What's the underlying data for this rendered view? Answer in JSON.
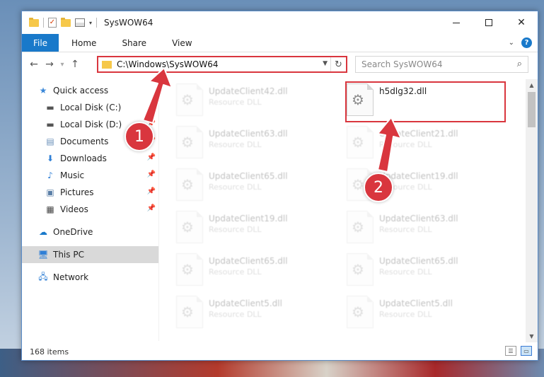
{
  "window": {
    "title": "SysWOW64",
    "controls": {
      "minimize": "–",
      "maximize": "",
      "close": "✕"
    }
  },
  "ribbon": {
    "tabs": [
      "File",
      "Home",
      "Share",
      "View"
    ],
    "help": "?"
  },
  "address": {
    "path": "C:\\Windows\\SysWOW64",
    "search_placeholder": "Search SysWOW64"
  },
  "sidebar": {
    "items": [
      {
        "label": "Quick access",
        "icon": "star-icon"
      },
      {
        "label": "Local Disk (C:)",
        "icon": "drive-icon"
      },
      {
        "label": "Local Disk (D:)",
        "icon": "drive-icon",
        "pinned": true
      },
      {
        "label": "Documents",
        "icon": "documents-icon",
        "pinned": true
      },
      {
        "label": "Downloads",
        "icon": "download-icon",
        "pinned": true
      },
      {
        "label": "Music",
        "icon": "music-icon",
        "pinned": true
      },
      {
        "label": "Pictures",
        "icon": "pictures-icon",
        "pinned": true
      },
      {
        "label": "Videos",
        "icon": "videos-icon",
        "pinned": true
      },
      {
        "label": "OneDrive",
        "icon": "cloud-icon"
      },
      {
        "label": "This PC",
        "icon": "monitor-icon",
        "selected": true
      },
      {
        "label": "Network",
        "icon": "network-icon"
      }
    ]
  },
  "files": {
    "left": [
      {
        "name": "UpdateClient42.dll",
        "type": "Resource DLL"
      },
      {
        "name": "UpdateClient63.dll",
        "type": "Resource DLL"
      },
      {
        "name": "UpdateClient65.dll",
        "type": "Resource DLL"
      },
      {
        "name": "UpdateClient19.dll",
        "type": "Resource DLL"
      },
      {
        "name": "UpdateClient65.dll",
        "type": "Resource DLL"
      },
      {
        "name": "UpdateClient5.dll",
        "type": "Resource DLL"
      }
    ],
    "right": [
      {
        "name": "h5dlg32.dll",
        "type": ""
      },
      {
        "name": "UpdateClient21.dll",
        "type": "Resource DLL"
      },
      {
        "name": "UpdateClient19.dll",
        "type": "Resource DLL"
      },
      {
        "name": "UpdateClient63.dll",
        "type": "Resource DLL"
      },
      {
        "name": "UpdateClient65.dll",
        "type": "Resource DLL"
      },
      {
        "name": "UpdateClient5.dll",
        "type": "Resource DLL"
      }
    ]
  },
  "status": {
    "item_count": "168 items"
  },
  "callouts": [
    {
      "number": "1"
    },
    {
      "number": "2"
    }
  ],
  "colors": {
    "accent": "#1979ca",
    "callout": "#d9363e"
  }
}
